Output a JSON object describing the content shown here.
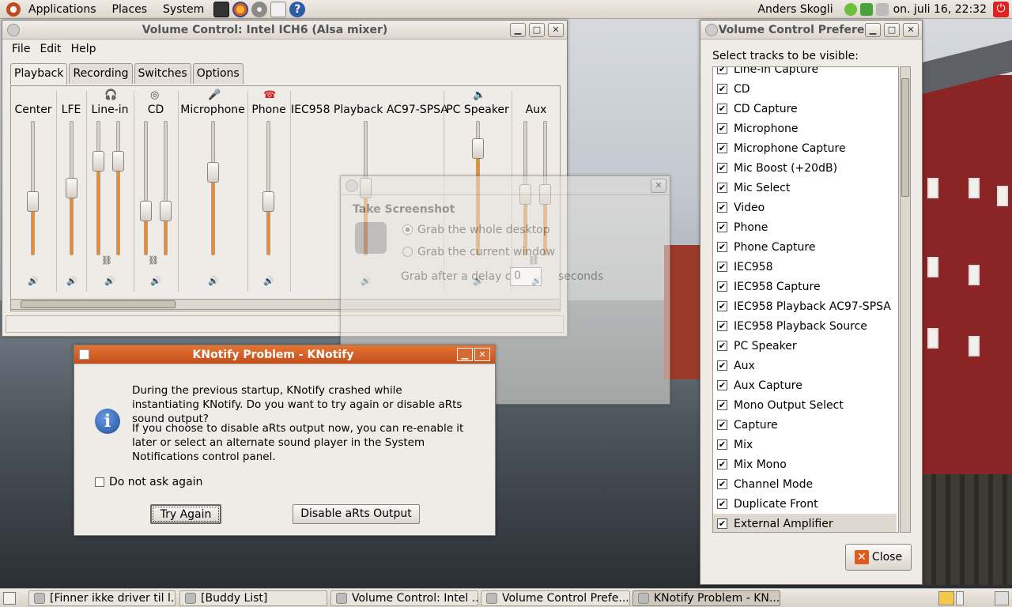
{
  "top_panel": {
    "menus": [
      "Applications",
      "Places",
      "System"
    ],
    "user": "Anders Skogli",
    "clock": "on. juli 16, 22:32"
  },
  "volume_control": {
    "title": "Volume Control: Intel ICH6 (Alsa mixer)",
    "menu": [
      "File",
      "Edit",
      "Help"
    ],
    "tabs": [
      "Playback",
      "Recording",
      "Switches",
      "Options"
    ],
    "channels": [
      "Center",
      "LFE",
      "Line-in",
      "CD",
      "Microphone",
      "Phone",
      "IEC958 Playback AC97-SPSA",
      "PC Speaker",
      "Aux"
    ],
    "levels": {
      "center": 0.4,
      "lfe": 0.5,
      "line_in_l": 0.7,
      "line_in_r": 0.7,
      "cd_l": 0.33,
      "cd_r": 0.33,
      "microphone": 0.62,
      "phone": 0.4,
      "iec958": 0.5,
      "pc_speaker": 0.8,
      "aux_l": 0.45,
      "aux_r": 0.45
    }
  },
  "screenshot_dialog": {
    "title": "Take Screenshot",
    "opt_desktop": "Grab the whole desktop",
    "opt_window": "Grab the current window",
    "delay_prefix": "Grab after a delay of",
    "delay_value": "0",
    "delay_suffix": "seconds"
  },
  "preferences": {
    "title": "Volume Control Prefere",
    "label": "Select tracks to be visible:",
    "tracks": [
      "Line-in Capture",
      "CD",
      "CD Capture",
      "Microphone",
      "Microphone Capture",
      "Mic Boost (+20dB)",
      "Mic Select",
      "Video",
      "Phone",
      "Phone Capture",
      "IEC958",
      "IEC958 Capture",
      "IEC958 Playback AC97-SPSA",
      "IEC958 Playback Source",
      "PC Speaker",
      "Aux",
      "Aux Capture",
      "Mono Output Select",
      "Capture",
      "Mix",
      "Mix Mono",
      "Channel Mode",
      "Duplicate Front",
      "External Amplifier"
    ],
    "close_label": "Close"
  },
  "knotify": {
    "title": "KNotify Problem - KNotify",
    "message1": "During the previous startup, KNotify crashed while instantiating KNotify. Do you want to try again or disable aRts sound output?",
    "message2": "If you choose to disable aRts output now, you can re-enable it later or select an alternate sound player in the System Notifications control panel.",
    "checkbox_label": "Do not ask again",
    "try_again": "Try Again",
    "disable": "Disable aRts Output"
  },
  "taskbar": {
    "items": [
      "[Finner ikke driver til l...",
      "[Buddy List]",
      "Volume Control: Intel ...",
      "Volume Control Prefe...",
      "KNotify Problem - KN..."
    ]
  }
}
